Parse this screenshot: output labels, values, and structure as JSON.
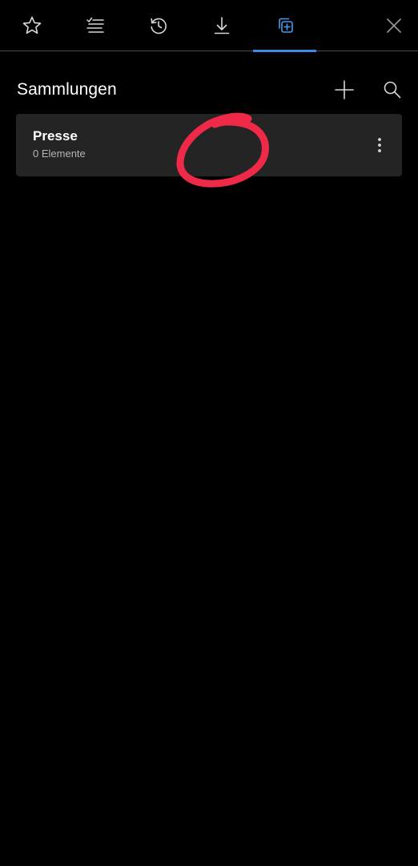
{
  "tabs": [
    {
      "id": "favorites",
      "icon": "star-icon"
    },
    {
      "id": "reading-list",
      "icon": "reading-list-icon"
    },
    {
      "id": "history",
      "icon": "history-icon"
    },
    {
      "id": "downloads",
      "icon": "download-icon"
    },
    {
      "id": "collections",
      "icon": "collections-icon",
      "active": true
    }
  ],
  "close_icon": "close-icon",
  "header": {
    "title": "Sammlungen",
    "add_icon": "plus-icon",
    "search_icon": "search-icon"
  },
  "collections": [
    {
      "title": "Presse",
      "subtitle": "0 Elemente",
      "menu_icon": "more-vertical-icon"
    }
  ],
  "annotation": {
    "shape": "hand-drawn-circle",
    "color": "#ee2a48"
  },
  "colors": {
    "background": "#000000",
    "card": "#242424",
    "accent": "#3c8ce7",
    "icon": "#d8d8d8",
    "secondary_text": "#b4b4b4"
  }
}
